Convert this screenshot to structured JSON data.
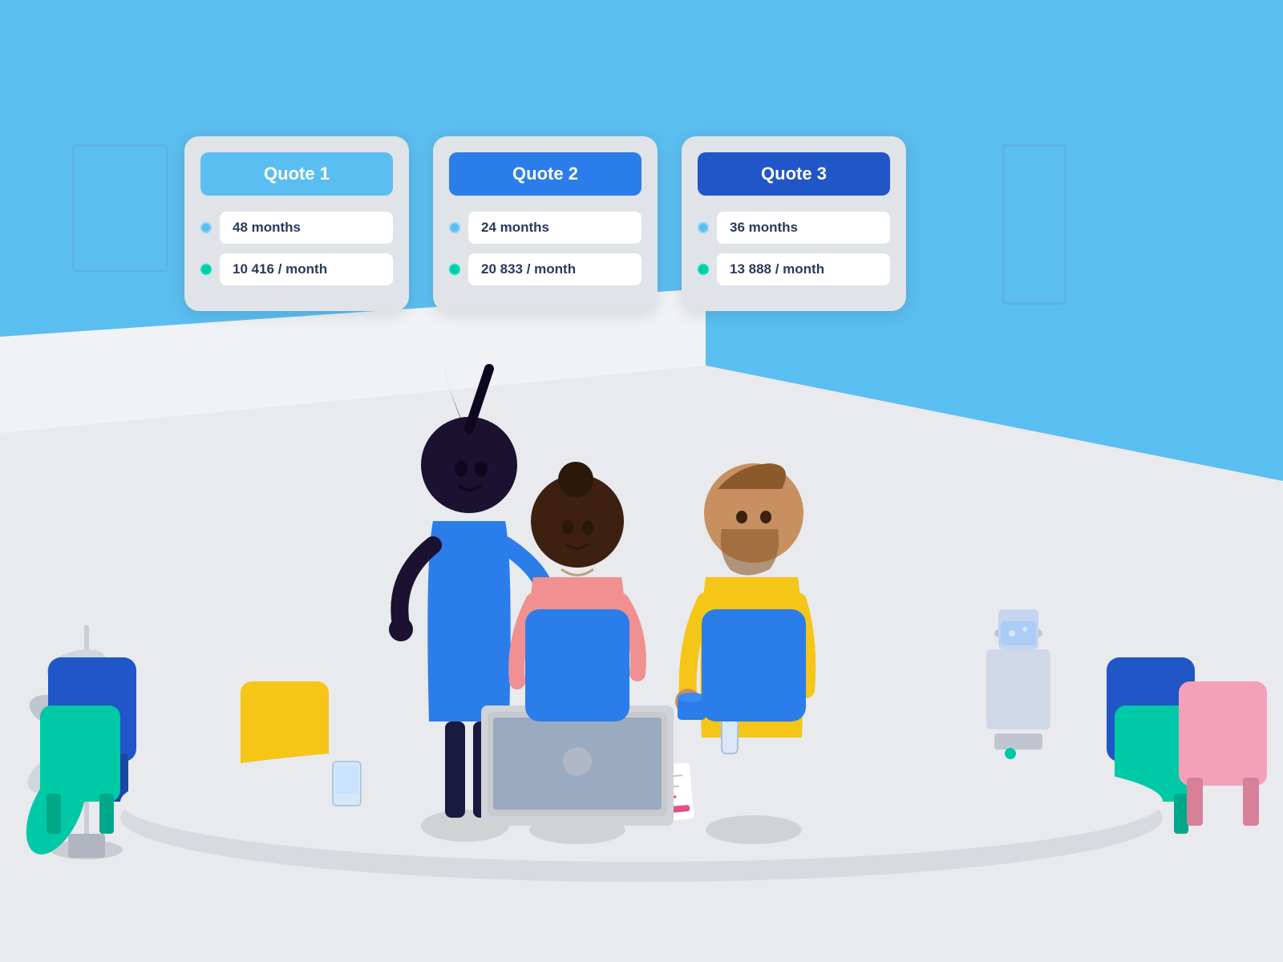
{
  "scene": {
    "background_color": "#5bbef0"
  },
  "cards": [
    {
      "id": "quote1",
      "title": "Quote 1",
      "header_style": "light",
      "duration": "48 months",
      "payment": "10 416 / month"
    },
    {
      "id": "quote2",
      "title": "Quote 2",
      "header_style": "medium",
      "duration": "24 months",
      "payment": "20 833 / month"
    },
    {
      "id": "quote3",
      "title": "Quote 3",
      "header_style": "dark",
      "duration": "36 months",
      "payment": "13 888 / month"
    }
  ]
}
